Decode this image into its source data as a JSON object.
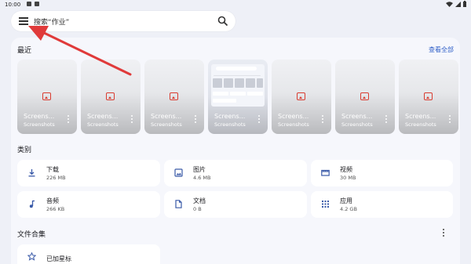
{
  "status_bar": {
    "time": "10:00"
  },
  "search": {
    "placeholder": "搜索“作业”"
  },
  "recent": {
    "title": "最近",
    "view_all": "查看全部",
    "items": [
      {
        "name": "Screens...",
        "folder": "Screenshots"
      },
      {
        "name": "Screens...",
        "folder": "Screenshots"
      },
      {
        "name": "Screens...",
        "folder": "Screenshots"
      },
      {
        "name": "Screens...",
        "folder": "Screenshots"
      },
      {
        "name": "Screens...",
        "folder": "Screenshots"
      },
      {
        "name": "Screens...",
        "folder": "Screenshots"
      },
      {
        "name": "Screens...",
        "folder": "Screenshots"
      }
    ]
  },
  "categories": {
    "title": "类别",
    "items": [
      {
        "label": "下载",
        "size": "226 MB",
        "icon": "download-icon"
      },
      {
        "label": "图片",
        "size": "4.6 MB",
        "icon": "image-icon"
      },
      {
        "label": "视频",
        "size": "30 MB",
        "icon": "video-icon"
      },
      {
        "label": "音频",
        "size": "266 KB",
        "icon": "music-icon"
      },
      {
        "label": "文档",
        "size": "0 B",
        "icon": "document-icon"
      },
      {
        "label": "应用",
        "size": "4.2 GB",
        "icon": "apps-icon"
      }
    ]
  },
  "collections": {
    "title": "文件合集",
    "items": [
      {
        "label": "已加星标",
        "icon": "star-icon"
      }
    ]
  },
  "colors": {
    "accent": "#2f5fc8",
    "icon_blue": "#3a5aa8",
    "annotation_arrow": "#e03a3a"
  }
}
